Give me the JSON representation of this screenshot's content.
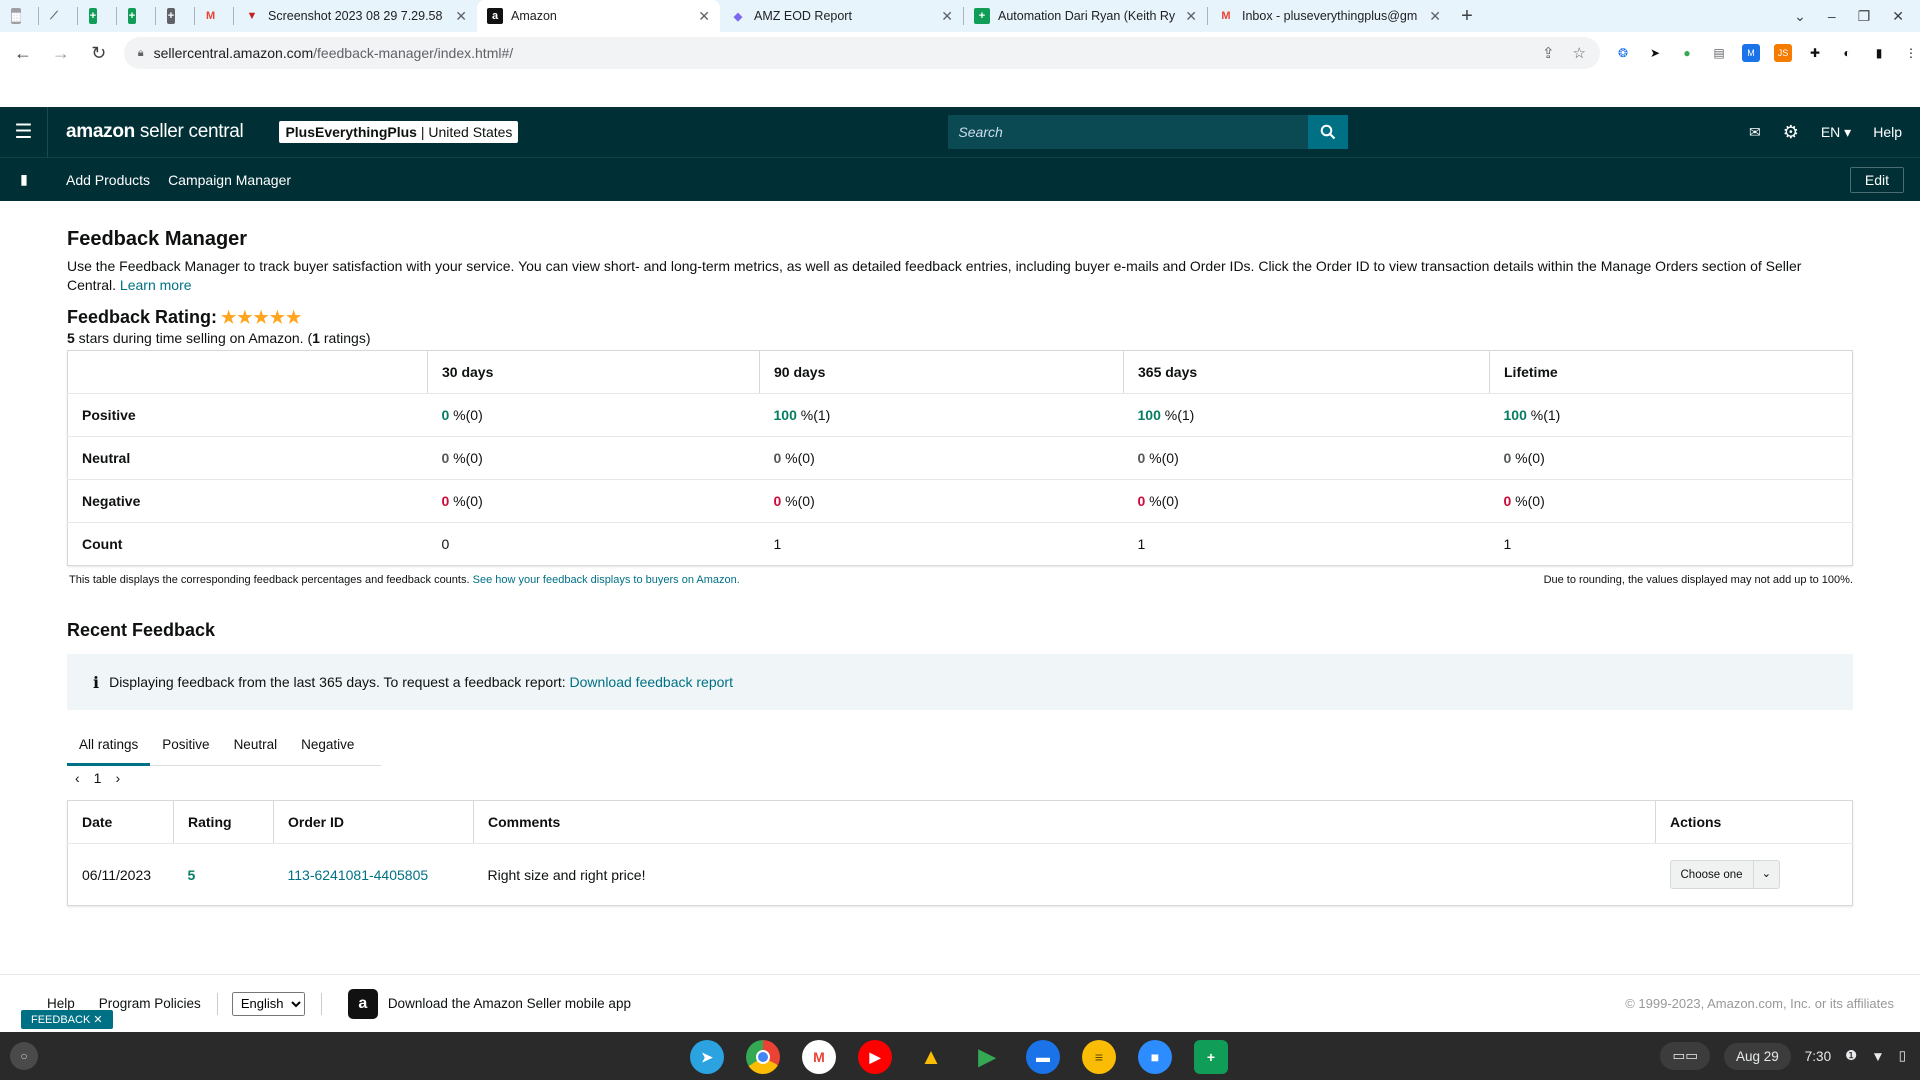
{
  "browser": {
    "tabs": [
      {
        "title": "",
        "icon": "sheets-icon"
      },
      {
        "title": "",
        "icon": "drive-icon"
      },
      {
        "title": "",
        "icon": "sheets-icon"
      },
      {
        "title": "",
        "icon": "sheets-icon"
      },
      {
        "title": "",
        "icon": "sheets-icon"
      },
      {
        "title": "",
        "icon": "gmail-icon"
      },
      {
        "title": "Screenshot 2023 08 29 7.29.58",
        "icon": "screenshot-icon"
      },
      {
        "title": "Amazon",
        "icon": "amazon-icon"
      },
      {
        "title": "AMZ EOD Report",
        "icon": "clickup-icon"
      },
      {
        "title": "Automation Dari Ryan (Keith Ry",
        "icon": "sheets-icon"
      },
      {
        "title": "Inbox - pluseverythingplus@gm",
        "icon": "gmail-icon"
      }
    ],
    "url_host": "sellercentral.amazon.com",
    "url_path": "/feedback-manager/index.html#/"
  },
  "nav": {
    "logo_brand": "amazon",
    "logo_rest": " seller central",
    "store_name": "PlusEverythingPlus",
    "store_region": " | United States",
    "search_placeholder": "Search",
    "language": "EN",
    "help": "Help",
    "sub_links": [
      "Add Products",
      "Campaign Manager"
    ],
    "edit": "Edit"
  },
  "page": {
    "title": "Feedback Manager",
    "intro": "Use the Feedback Manager to track buyer satisfaction with your service. You can view short- and long-term metrics, as well as detailed feedback entries, including buyer e-mails and Order IDs. Click the Order ID to view transaction details within the Manage Orders section of Seller Central.",
    "learn_more": "Learn more",
    "rating_title": "Feedback Rating:",
    "stars": "★★★★★",
    "rating_stars_value": 5,
    "rating_sub_stars": "5",
    "rating_sub_mid": " stars during time selling on Amazon. (",
    "rating_sub_count": "1",
    "rating_sub_end": " ratings)"
  },
  "summary": {
    "columns": [
      "",
      "30 days",
      "90 days",
      "365 days",
      "Lifetime"
    ],
    "rows": [
      {
        "label": "Positive",
        "cells": [
          {
            "n": "0",
            "s": " %(0)"
          },
          {
            "n": "100",
            "s": " %(1)"
          },
          {
            "n": "100",
            "s": " %(1)"
          },
          {
            "n": "100",
            "s": " %(1)"
          }
        ]
      },
      {
        "label": "Neutral",
        "cells": [
          {
            "n": "0",
            "s": " %(0)"
          },
          {
            "n": "0",
            "s": " %(0)"
          },
          {
            "n": "0",
            "s": " %(0)"
          },
          {
            "n": "0",
            "s": " %(0)"
          }
        ]
      },
      {
        "label": "Negative",
        "cells": [
          {
            "n": "0",
            "s": " %(0)"
          },
          {
            "n": "0",
            "s": " %(0)"
          },
          {
            "n": "0",
            "s": " %(0)"
          },
          {
            "n": "0",
            "s": " %(0)"
          }
        ]
      },
      {
        "label": "Count",
        "cells": [
          "0",
          "1",
          "1",
          "1"
        ]
      }
    ],
    "note": "This table displays the corresponding feedback percentages and feedback counts.",
    "note_link": "See how your feedback displays to buyers on Amazon.",
    "rounding": "Due to rounding, the values displayed may not add up to 100%."
  },
  "recent": {
    "title": "Recent Feedback",
    "info": "Displaying feedback from the last 365 days. To request a feedback report:",
    "info_link": "Download feedback report",
    "tabs": [
      "All ratings",
      "Positive",
      "Neutral",
      "Negative"
    ],
    "page": "1",
    "columns": [
      "Date",
      "Rating",
      "Order ID",
      "Comments",
      "Actions"
    ],
    "rows": [
      {
        "date": "06/11/2023",
        "rating": "5",
        "order_id": "113-6241081-4405805",
        "comment": "Right size and right price!",
        "action": "Choose one"
      }
    ]
  },
  "footer": {
    "help": "Help",
    "policies": "Program Policies",
    "language": "English",
    "app_text": "Download the Amazon Seller mobile app",
    "copyright": "© 1999-2023, Amazon.com, Inc. or its affiliates",
    "feedback_tag": "FEEDBACK"
  },
  "shelf": {
    "date": "Aug 29",
    "time": "7:30"
  },
  "colors": {
    "nav_bg": "#002f36",
    "link": "#007185",
    "positive": "#067d62",
    "negative": "#cc0c39",
    "star": "#ffa41c"
  }
}
